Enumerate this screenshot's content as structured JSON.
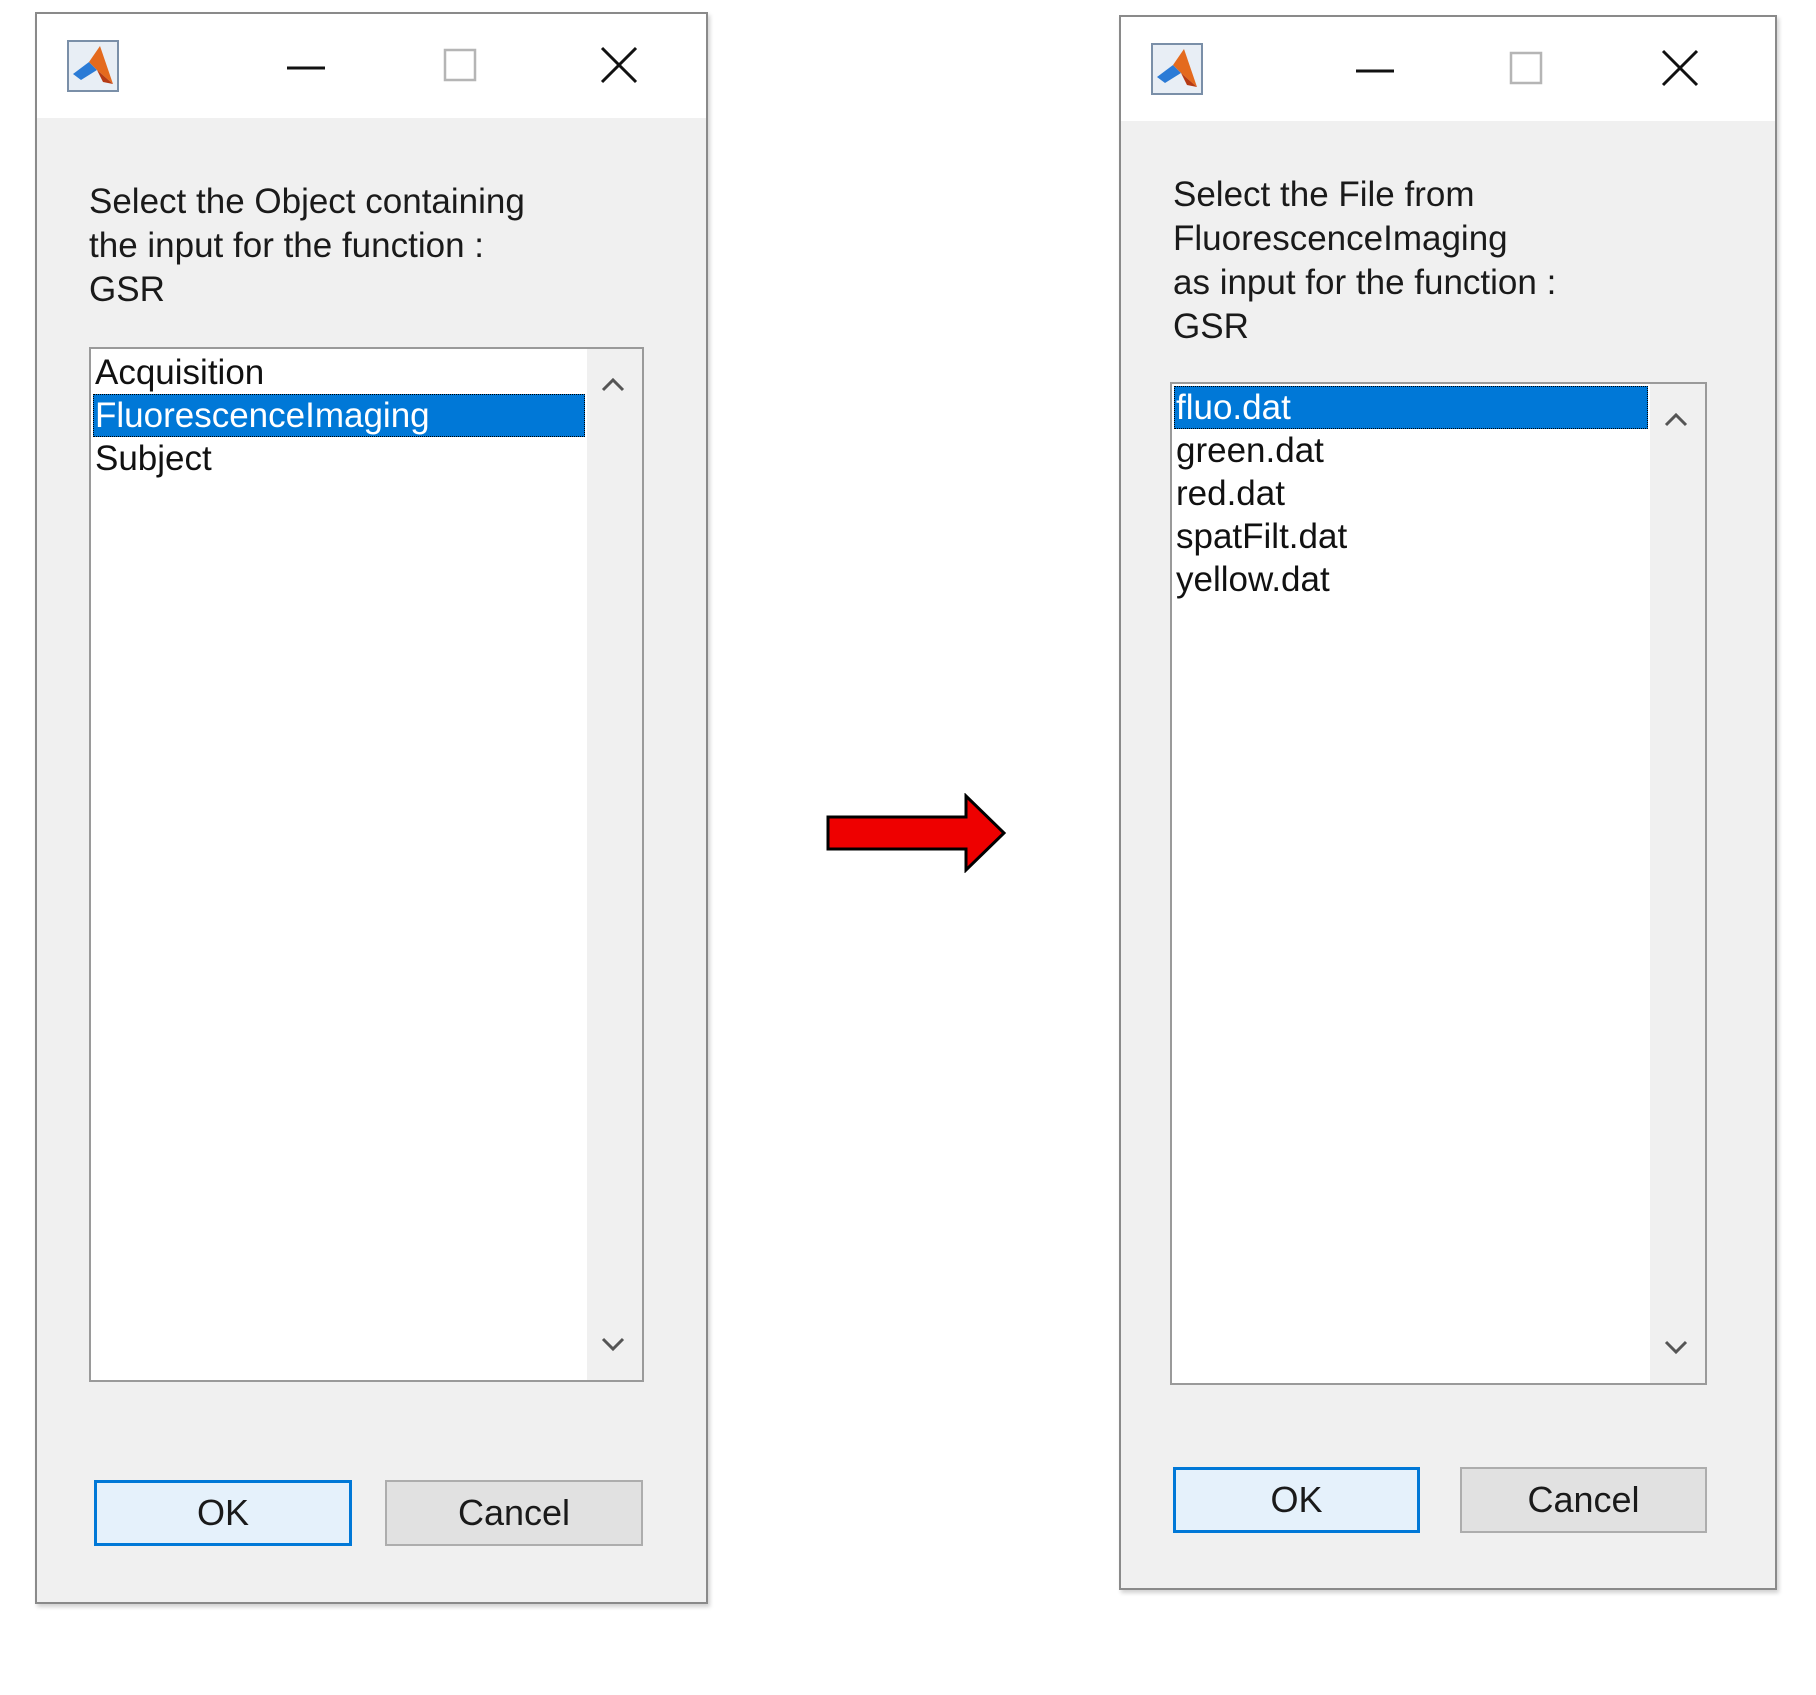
{
  "left_dialog": {
    "prompt": "Select the Object containing\nthe input for the function :\nGSR",
    "items": [
      {
        "label": "Acquisition",
        "selected": false
      },
      {
        "label": "FluorescenceImaging",
        "selected": true
      },
      {
        "label": "Subject",
        "selected": false
      }
    ],
    "ok_label": "OK",
    "cancel_label": "Cancel"
  },
  "right_dialog": {
    "prompt": "Select the File from\nFluorescenceImaging\nas input for the function :\nGSR",
    "items": [
      {
        "label": "fluo.dat",
        "selected": true
      },
      {
        "label": "green.dat",
        "selected": false
      },
      {
        "label": "red.dat",
        "selected": false
      },
      {
        "label": "spatFilt.dat",
        "selected": false
      },
      {
        "label": "yellow.dat",
        "selected": false
      }
    ],
    "ok_label": "OK",
    "cancel_label": "Cancel"
  },
  "icons": {
    "app": "matlab-logo-icon",
    "minimize": "minimize-icon",
    "maximize": "maximize-icon",
    "close": "close-icon",
    "scroll_up": "chevron-up-icon",
    "scroll_down": "chevron-down-icon",
    "transition": "right-arrow-icon"
  },
  "colors": {
    "selection": "#0078d7",
    "arrow_fill": "#ee0000",
    "dialog_bg": "#f0f0f0"
  }
}
